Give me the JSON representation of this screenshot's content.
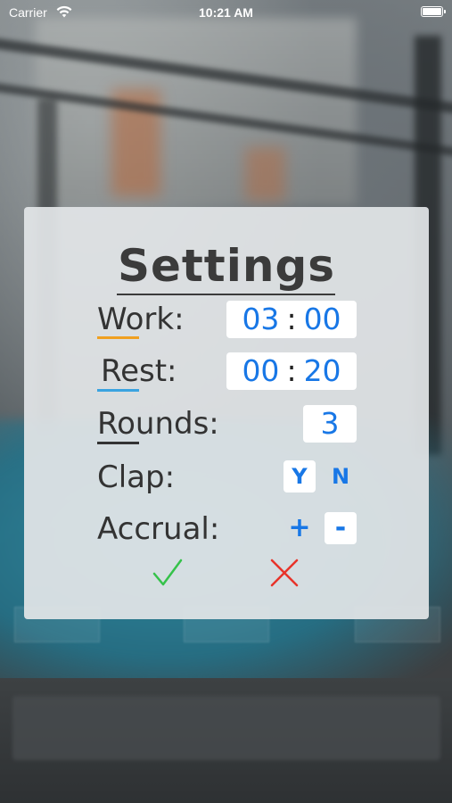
{
  "status_bar": {
    "carrier": "Carrier",
    "time": "10:21 AM"
  },
  "dialog": {
    "title": "Settings",
    "rows": {
      "work": {
        "label": "Work:",
        "minutes": "03",
        "seconds": "00",
        "separator": ":"
      },
      "rest": {
        "label": "Rest:",
        "minutes": "00",
        "seconds": "20",
        "separator": ":"
      },
      "rounds": {
        "label": "Rounds:",
        "value": "3"
      },
      "clap": {
        "label": "Clap:",
        "yes": "Y",
        "no": "N",
        "selected": "Y"
      },
      "accrual": {
        "label": "Accrual:",
        "plus": "+",
        "minus": "-",
        "selected": "-"
      }
    },
    "confirm_icon": "checkmark-icon",
    "cancel_icon": "close-x-icon"
  },
  "colors": {
    "accent_blue": "#1877e6",
    "work_underline": "#f0a020",
    "rest_underline": "#3aa3e0",
    "rounds_underline": "#333333",
    "confirm_green": "#35c24a",
    "cancel_red": "#e8332a",
    "dialog_bg": "#e2e5e7"
  }
}
